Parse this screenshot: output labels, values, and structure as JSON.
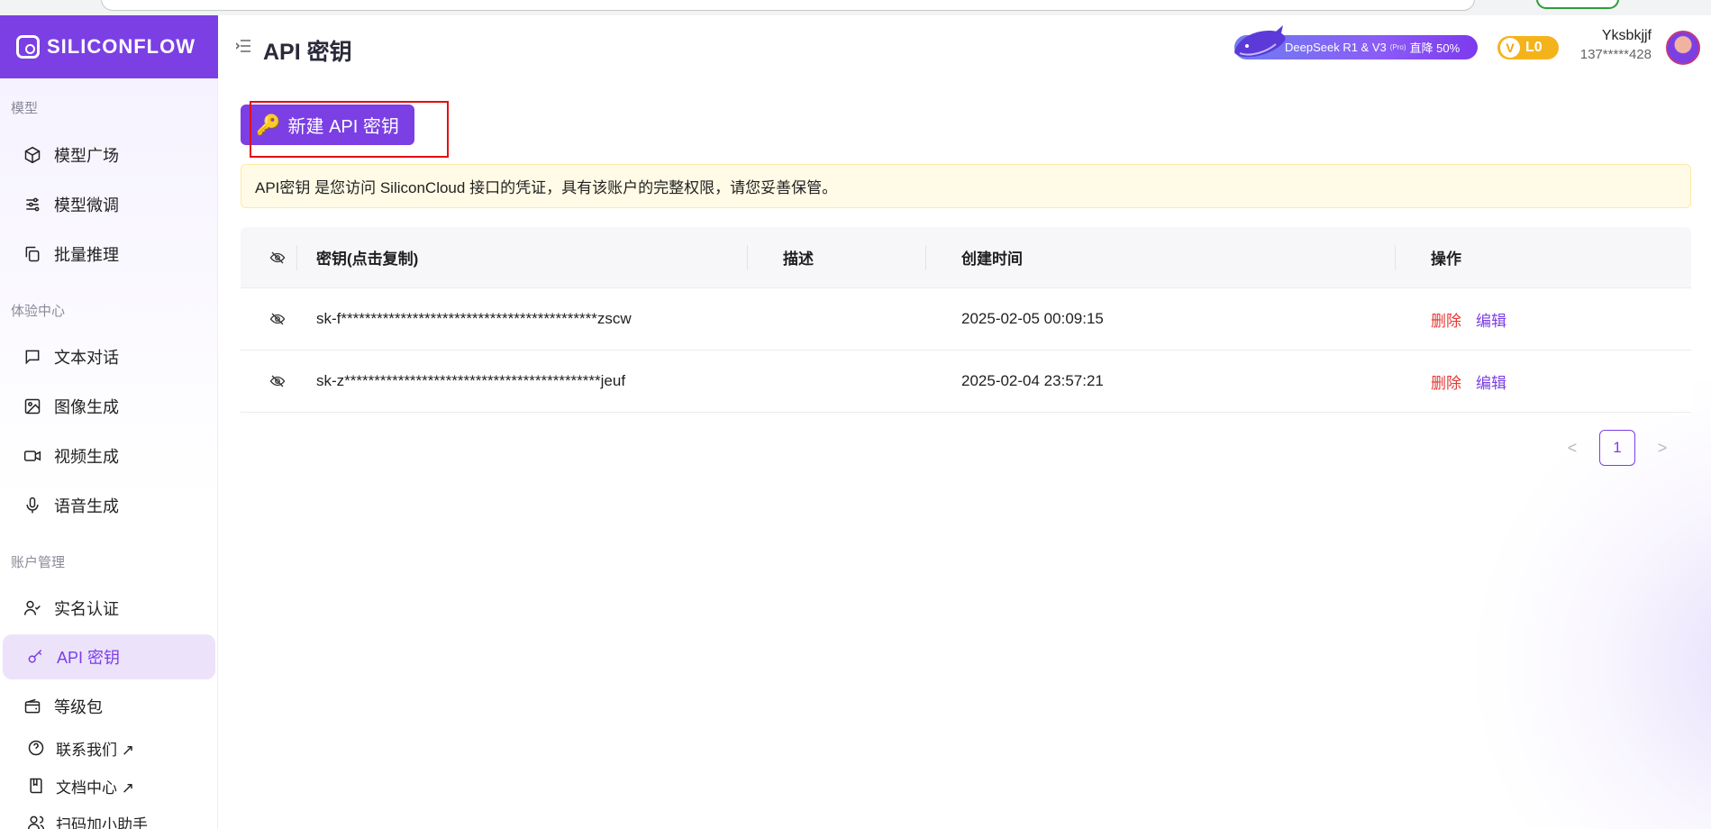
{
  "brand": {
    "name": "SILICONFLOW"
  },
  "sidebar": {
    "sections": [
      {
        "label": "模型"
      },
      {
        "label": "体验中心"
      },
      {
        "label": "账户管理"
      }
    ],
    "items": [
      {
        "label": "模型广场",
        "icon": "cube-icon"
      },
      {
        "label": "模型微调",
        "icon": "sliders-icon"
      },
      {
        "label": "批量推理",
        "icon": "copy-icon"
      },
      {
        "label": "文本对话",
        "icon": "chat-icon"
      },
      {
        "label": "图像生成",
        "icon": "image-icon"
      },
      {
        "label": "视频生成",
        "icon": "video-icon"
      },
      {
        "label": "语音生成",
        "icon": "mic-icon"
      },
      {
        "label": "实名认证",
        "icon": "user-check-icon"
      },
      {
        "label": "API 密钥",
        "icon": "key-icon",
        "active": true
      },
      {
        "label": "等级包",
        "icon": "wallet-icon"
      },
      {
        "label": "联系我们 ↗",
        "icon": "help-icon"
      },
      {
        "label": "文档中心 ↗",
        "icon": "book-icon"
      },
      {
        "label": "扫码加小助手",
        "icon": "users-icon"
      }
    ]
  },
  "header": {
    "title": "API 密钥",
    "promo": {
      "text_main": "DeepSeek R1 & V3",
      "text_small": "(Pro)",
      "text_tail": "直降 50%"
    },
    "level": {
      "badge_letter": "V",
      "label": "L0"
    },
    "user": {
      "name": "Yksbkjjf",
      "phone": "137*****428"
    }
  },
  "actions": {
    "new_key_label": "新建 API 密钥"
  },
  "notice": {
    "text": "API密钥 是您访问 SiliconCloud 接口的凭证，具有该账户的完整权限，请您妥善保管。"
  },
  "table": {
    "columns": {
      "key": "密钥(点击复制)",
      "desc": "描述",
      "time": "创建时间",
      "ops": "操作"
    },
    "rows": [
      {
        "key": "sk-f*******************************************zscw",
        "desc": "",
        "time": "2025-02-05 00:09:15",
        "delete": "删除",
        "edit": "编辑"
      },
      {
        "key": "sk-z*******************************************jeuf",
        "desc": "",
        "time": "2025-02-04 23:57:21",
        "delete": "删除",
        "edit": "编辑"
      }
    ]
  },
  "pagination": {
    "prev": "<",
    "current": "1",
    "next": ">"
  },
  "colors": {
    "accent": "#7b3fe4",
    "danger": "#e53935",
    "notice_bg": "#fffbe6"
  }
}
